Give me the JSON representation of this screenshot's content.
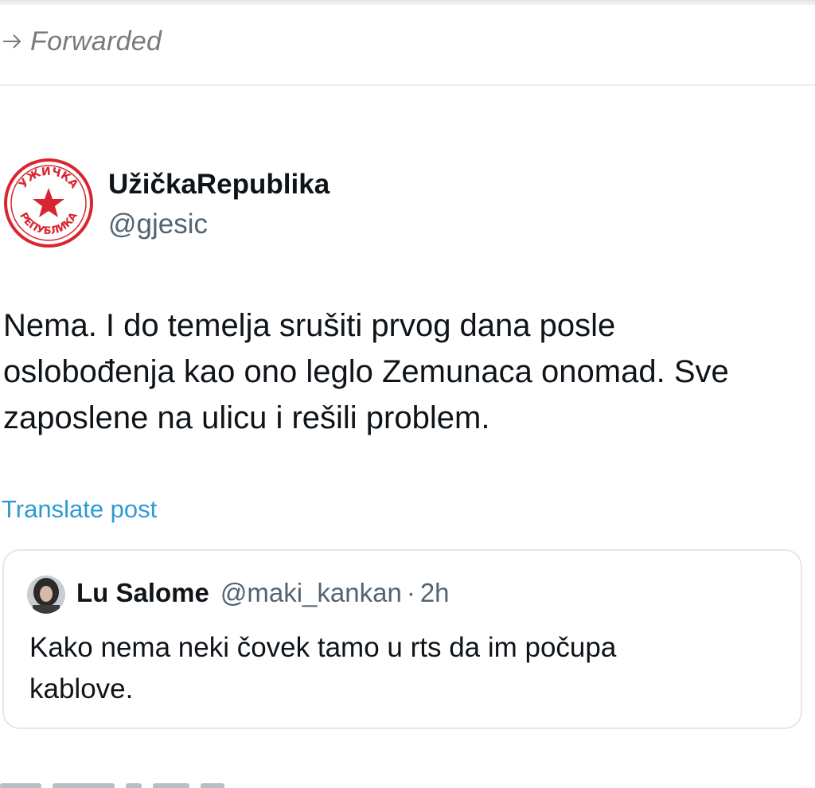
{
  "forward": {
    "label": "Forwarded",
    "icon": "forward-arrow-icon"
  },
  "tweet": {
    "author": {
      "display_name": "UžičkaRepublika",
      "handle": "@gjesic",
      "avatar": "red-star-stamp-logo",
      "avatar_text": "УЖИЧКА РЕПУБЛИКА"
    },
    "text_lines": [
      "Nema. I do temelja srušiti prvog dana posle",
      "oslobođenja kao ono leglo Zemunaca onomad. Sve",
      "zaposlene na ulicu i rešili problem."
    ],
    "translate_label": "Translate post",
    "quoted": {
      "display_name": "Lu Salome",
      "handle": "@maki_kankan",
      "separator": "·",
      "time": "2h",
      "avatar": "profile-photo",
      "text_lines": [
        "Kako nema neki čovek tamo u rts da im počupa",
        "kablove."
      ]
    }
  },
  "colors": {
    "accent_link": "#2d9bd3",
    "text_primary": "#0f1419",
    "text_secondary": "#536471",
    "forward_gray": "#7a7a7a",
    "stamp_red": "#d9252f",
    "border": "#e3e7ea"
  }
}
